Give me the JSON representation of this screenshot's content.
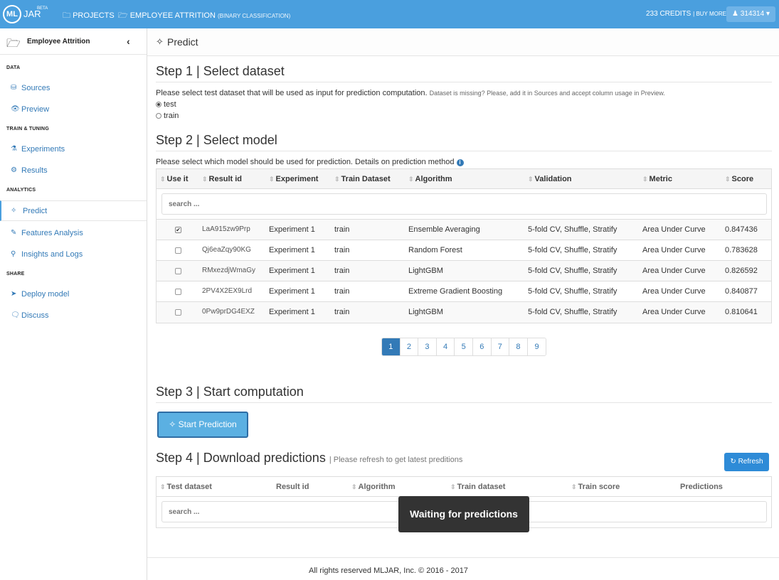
{
  "topbar": {
    "logo_ml": "ML",
    "logo_jar": "JAR",
    "logo_beta": "BETA",
    "projects": "PROJECTS",
    "project_name": "EMPLOYEE ATTRITION",
    "project_type": "(BINARY CLASSIFICATION)",
    "credits": "233 CREDITS",
    "buy_more": "| BUY MORE",
    "user": "314314"
  },
  "sidebar": {
    "title": "Employee Attrition",
    "sections": {
      "data": "DATA",
      "train": "TRAIN & TUNING",
      "analytics": "ANALYTICS",
      "share": "SHARE"
    },
    "items": {
      "sources": "Sources",
      "preview": "Preview",
      "experiments": "Experiments",
      "results": "Results",
      "predict": "Predict",
      "features": "Features Analysis",
      "insights": "Insights and Logs",
      "deploy": "Deploy model",
      "discuss": "Discuss"
    }
  },
  "page": {
    "title": "Predict"
  },
  "step1": {
    "title": "Step 1 | Select dataset",
    "desc": "Please select test dataset that will be used as input for prediction computation.",
    "missing": "Dataset is missing? Please, add it in Sources and accept column usage in Preview.",
    "options": [
      "test",
      "train"
    ],
    "selected": "test"
  },
  "step2": {
    "title": "Step 2 | Select model",
    "desc": "Please select which model should be used for prediction. Details on prediction method",
    "columns": [
      "Use it",
      "Result id",
      "Experiment",
      "Train Dataset",
      "Algorithm",
      "Validation",
      "Metric",
      "Score"
    ],
    "search_placeholder": "search ...",
    "rows": [
      {
        "checked": true,
        "result_id": "LaA915zw9Prp",
        "experiment": "Experiment 1",
        "train": "train",
        "algorithm": "Ensemble Averaging",
        "validation": "5-fold CV, Shuffle, Stratify",
        "metric": "Area Under Curve",
        "score": "0.847436"
      },
      {
        "checked": false,
        "result_id": "Qj6eaZqy90KG",
        "experiment": "Experiment 1",
        "train": "train",
        "algorithm": "Random Forest",
        "validation": "5-fold CV, Shuffle, Stratify",
        "metric": "Area Under Curve",
        "score": "0.783628"
      },
      {
        "checked": false,
        "result_id": "RMxezdjWmaGy",
        "experiment": "Experiment 1",
        "train": "train",
        "algorithm": "LightGBM",
        "validation": "5-fold CV, Shuffle, Stratify",
        "metric": "Area Under Curve",
        "score": "0.826592"
      },
      {
        "checked": false,
        "result_id": "2PV4X2EX9Lrd",
        "experiment": "Experiment 1",
        "train": "train",
        "algorithm": "Extreme Gradient Boosting",
        "validation": "5-fold CV, Shuffle, Stratify",
        "metric": "Area Under Curve",
        "score": "0.840877"
      },
      {
        "checked": false,
        "result_id": "0Pw9prDG4EXZ",
        "experiment": "Experiment 1",
        "train": "train",
        "algorithm": "LightGBM",
        "validation": "5-fold CV, Shuffle, Stratify",
        "metric": "Area Under Curve",
        "score": "0.810641"
      }
    ],
    "pages": [
      "1",
      "2",
      "3",
      "4",
      "5",
      "6",
      "7",
      "8",
      "9"
    ],
    "current_page": "1"
  },
  "step3": {
    "title": "Step 3 | Start computation",
    "button": "Start Prediction"
  },
  "step4": {
    "title": "Step 4 | Download predictions",
    "note": "| Please refresh to get latest preditions",
    "refresh": "Refresh",
    "columns": [
      "Test dataset",
      "Result id",
      "Algorithm",
      "Train dataset",
      "Train score",
      "Predictions"
    ],
    "search_placeholder": "search ..."
  },
  "tooltip": "Waiting for predictions",
  "footer": "All rights reserved MLJAR, Inc. © 2016 - 2017",
  "colors": {
    "accent": "#4a9fde",
    "link": "#337ab7"
  }
}
